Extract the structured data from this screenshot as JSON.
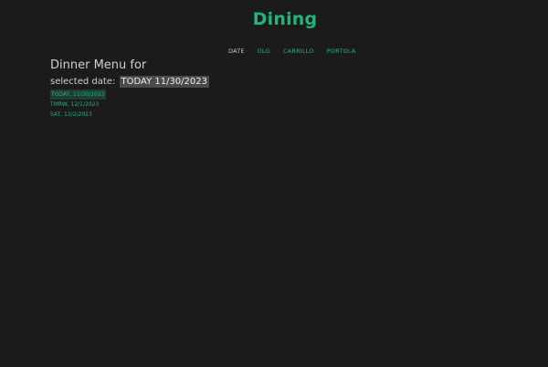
{
  "header": {
    "title": "Dining"
  },
  "nav": {
    "items": [
      {
        "label": "DATE",
        "active": true
      },
      {
        "label": "DLG",
        "active": false
      },
      {
        "label": "CARRILLO",
        "active": false
      },
      {
        "label": "PORTOLA",
        "active": false
      }
    ]
  },
  "main": {
    "heading": "Dinner Menu for",
    "selected_label": "selected date:",
    "selected_value": "TODAY 11/30/2023",
    "date_options": [
      {
        "label": "TODAY, 11/30/2023",
        "current": true
      },
      {
        "label": "TMRW, 12/1/2023",
        "current": false
      },
      {
        "label": "SAT, 12/2/2023",
        "current": false
      }
    ]
  },
  "colors": {
    "background": "#1b1b1c",
    "accent": "#1fb57b",
    "text": "#cfcfcf",
    "highlight": "#4a4a4a"
  }
}
